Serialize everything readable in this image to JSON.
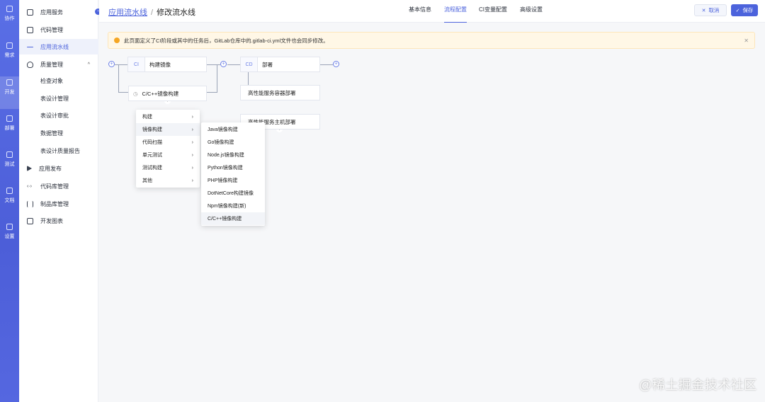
{
  "rail": {
    "items": [
      {
        "label": "协作",
        "icon": "bell-icon"
      },
      {
        "label": "需求",
        "icon": "layers-icon"
      },
      {
        "label": "开发",
        "icon": "code-icon"
      },
      {
        "label": "部署",
        "icon": "gear-icon"
      },
      {
        "label": "测试",
        "icon": "clipboard-icon"
      },
      {
        "label": "文档",
        "icon": "inbox-icon"
      },
      {
        "label": "设置",
        "icon": "server-icon"
      }
    ]
  },
  "sidebar": {
    "items": [
      {
        "label": "应用服务"
      },
      {
        "label": "代码管理"
      },
      {
        "label": "应用流水线"
      },
      {
        "label": "质量管理"
      },
      {
        "label": "检查对象"
      },
      {
        "label": "表设计管理"
      },
      {
        "label": "表设计审批"
      },
      {
        "label": "数据管理"
      },
      {
        "label": "表设计质量报告"
      },
      {
        "label": "应用发布"
      },
      {
        "label": "代码库管理"
      },
      {
        "label": "制品库管理"
      },
      {
        "label": "开发图表"
      }
    ]
  },
  "header": {
    "breadcrumb_link": "应用流水线",
    "breadcrumb_sep": "/",
    "breadcrumb_current": "修改流水线",
    "tabs": [
      {
        "label": "基本信息"
      },
      {
        "label": "流程配置"
      },
      {
        "label": "CI变量配置"
      },
      {
        "label": "高级设置"
      }
    ],
    "cancel_label": "取消",
    "save_label": "保存"
  },
  "notice": {
    "text": "此页面定义了CI阶段或其中的任务后，GitLab仓库中的.gitlab-ci.yml文件也会同步修改。"
  },
  "pipeline": {
    "ci_tag": "CI",
    "ci_stage_label": "构建镜像",
    "ci_job_label": "C/C++镜像构建",
    "cd_tag": "CD",
    "cd_stage_label": "部署",
    "cd_job_1": "高性能服务容器部署",
    "cd_job_2": "高性能服务主机部署"
  },
  "menu_primary": {
    "items": [
      {
        "label": "构建"
      },
      {
        "label": "镜像构建"
      },
      {
        "label": "代码扫描"
      },
      {
        "label": "单元测试"
      },
      {
        "label": "测试构建"
      },
      {
        "label": "其他"
      }
    ]
  },
  "menu_secondary": {
    "items": [
      {
        "label": "Java镜像构建"
      },
      {
        "label": "Go镜像构建"
      },
      {
        "label": "Node.js镜像构建"
      },
      {
        "label": "Python镜像构建"
      },
      {
        "label": "PHP镜像构建"
      },
      {
        "label": "DotNetCore构建镜像"
      },
      {
        "label": "Npm镜像构建(新)"
      },
      {
        "label": "C/C++镜像构建"
      }
    ]
  },
  "watermark": "@稀土掘金技术社区",
  "colors": {
    "accent": "#4c63dc",
    "rail": "#5a6fe6",
    "warning": "#f5a623"
  }
}
